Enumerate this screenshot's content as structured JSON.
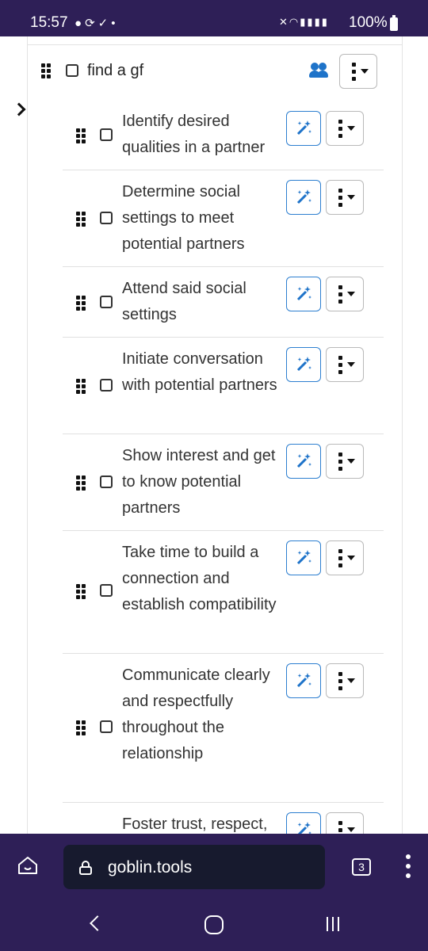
{
  "status_bar": {
    "time": "15:57",
    "notification_icons": [
      "chat-icon",
      "sync-icon",
      "download-icon",
      "dot-icon"
    ],
    "system_icons": [
      "mute-icon",
      "wifi-icon",
      "signal-icon",
      "signal-icon"
    ],
    "battery": "100%"
  },
  "root_task": {
    "title": "find a gf",
    "icon": "people-icon",
    "checked": false
  },
  "subtasks": [
    {
      "text": "Identify desired qualities in a partner",
      "checked": false
    },
    {
      "text": "Determine social settings to meet potential partners",
      "checked": false
    },
    {
      "text": "Attend said social settings",
      "checked": false
    },
    {
      "text": "Initiate conversation with potential partners",
      "checked": false
    },
    {
      "text": "Show interest and get to know potential partners",
      "checked": false
    },
    {
      "text": "Take time to build a connection and establish compatibility",
      "checked": false
    },
    {
      "text": "Communicate clearly and respectfully throughout the relationship",
      "checked": false
    },
    {
      "text": "Foster trust, respect,",
      "checked": false
    }
  ],
  "browser": {
    "url": "goblin.tools",
    "tab_count": "3"
  },
  "colors": {
    "system_bar": "#2e1f57",
    "url_pill": "#171a2e",
    "accent_blue": "#2d7fd0"
  }
}
